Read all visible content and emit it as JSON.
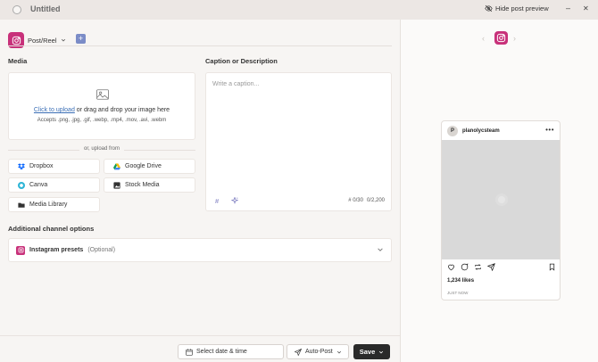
{
  "window": {
    "title": "Untitled",
    "hide_preview_label": "Hide post preview",
    "minimize_glyph": "–",
    "close_glyph": "✕"
  },
  "composer": {
    "post_type": "Post/Reel",
    "add_glyph": "+",
    "media_label": "Media",
    "upload": {
      "link_text": "Click to upload",
      "rest_text": " or drag and drop your image here",
      "accepts": "Accepts .png, .jpg, .gif, .webp, .mp4, .mov, .avi, .webm"
    },
    "or_upload_from": "or, upload from",
    "sources": [
      "Dropbox",
      "Google Drive",
      "Canva",
      "Stock Media",
      "Media Library"
    ],
    "caption_label": "Caption or Description",
    "caption_placeholder": "Write a caption...",
    "hashtag_count": "# 0/30",
    "char_count": "0/2,200",
    "additional_label": "Additional channel options",
    "presets_label": "Instagram presets",
    "presets_optional": "(Optional)"
  },
  "bottom": {
    "date_label": "Select date & time",
    "auto_label": "Auto-Post",
    "save_label": "Save"
  },
  "preview": {
    "avatar_letter": "P",
    "handle": "planolycsteam",
    "more_glyph": "•••",
    "likes": "1,234 likes",
    "time": "JUST NOW"
  },
  "colors": {
    "instagram": "#c8317a",
    "link": "#3b6fb6",
    "save_bg": "#2a2a2a"
  }
}
